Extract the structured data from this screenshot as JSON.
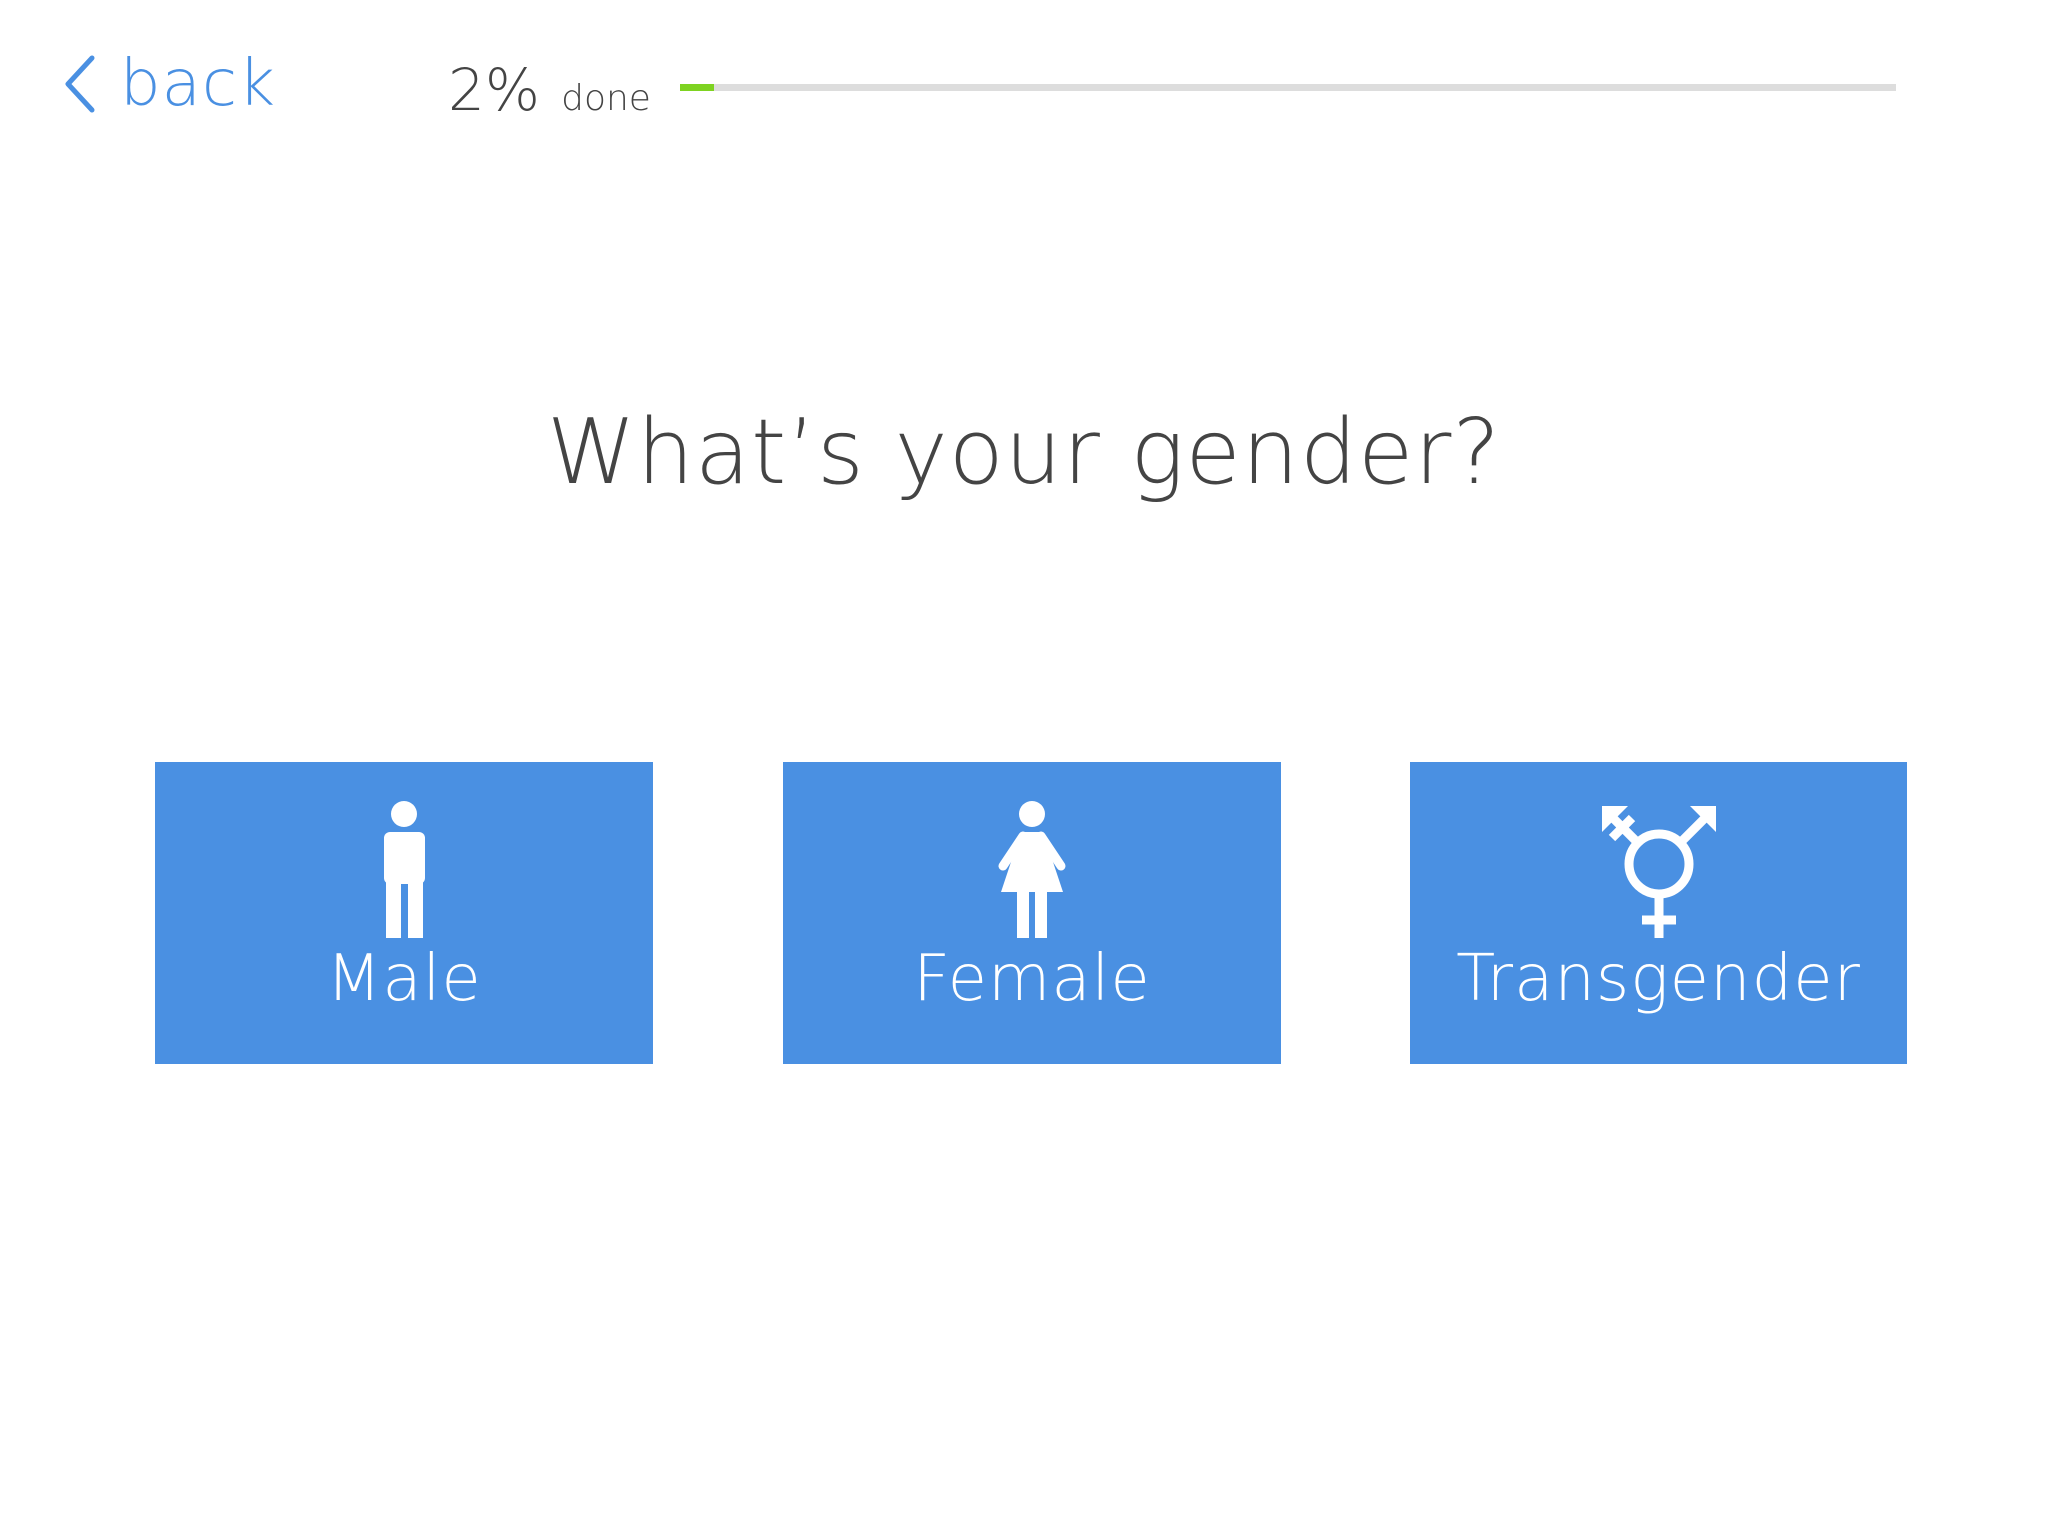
{
  "nav": {
    "back_label": "back",
    "back_icon": "chevron-left-icon"
  },
  "progress": {
    "percent_label": "2%",
    "done_label": "done",
    "value": 0.028,
    "fill_color": "#7ed321",
    "track_color": "#dddddd"
  },
  "question": {
    "title": "What’s your gender?"
  },
  "options": [
    {
      "label": "Male",
      "icon": "male-figure-icon"
    },
    {
      "label": "Female",
      "icon": "female-figure-icon"
    },
    {
      "label": "Transgender",
      "icon": "transgender-symbol-icon"
    }
  ],
  "colors": {
    "accent": "#4a90e2",
    "text": "#444444",
    "background": "#ffffff"
  }
}
